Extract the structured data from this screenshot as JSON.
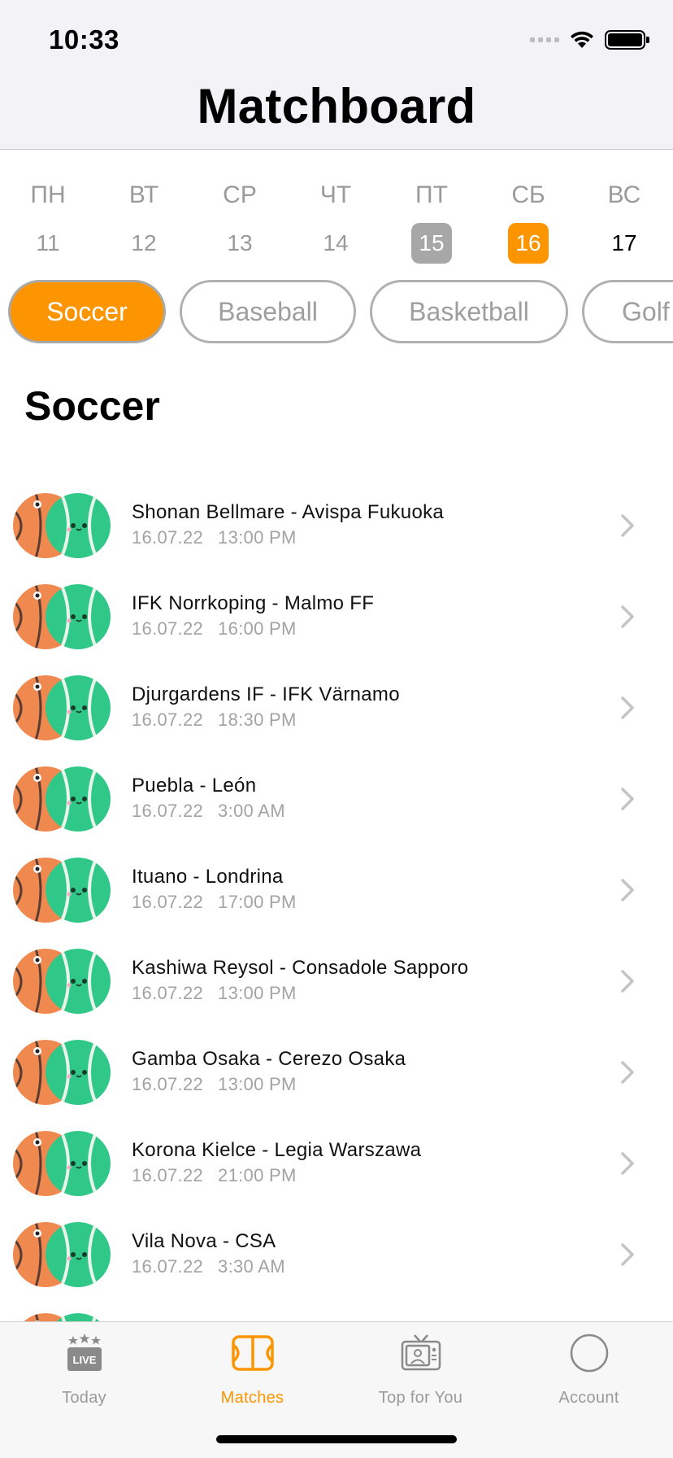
{
  "status_bar": {
    "time": "10:33"
  },
  "header": {
    "title": "Matchboard"
  },
  "week": [
    {
      "weekday": "ПН",
      "date": "11",
      "state": "normal"
    },
    {
      "weekday": "ВТ",
      "date": "12",
      "state": "normal"
    },
    {
      "weekday": "СР",
      "date": "13",
      "state": "normal"
    },
    {
      "weekday": "ЧТ",
      "date": "14",
      "state": "normal"
    },
    {
      "weekday": "ПТ",
      "date": "15",
      "state": "today"
    },
    {
      "weekday": "СБ",
      "date": "16",
      "state": "selected"
    },
    {
      "weekday": "ВС",
      "date": "17",
      "state": "upcoming"
    }
  ],
  "sports": [
    {
      "label": "Soccer",
      "active": true
    },
    {
      "label": "Baseball",
      "active": false
    },
    {
      "label": "Basketball",
      "active": false
    },
    {
      "label": "Golf",
      "active": false
    }
  ],
  "section_title": "Soccer",
  "matches": [
    {
      "teams": "Shonan Bellmare - Avispa Fukuoka",
      "date": "16.07.22",
      "time": "13:00 PM"
    },
    {
      "teams": "IFK Norrkoping - Malmo FF",
      "date": "16.07.22",
      "time": "16:00 PM"
    },
    {
      "teams": "Djurgardens IF - IFK Värnamo",
      "date": "16.07.22",
      "time": "18:30 PM"
    },
    {
      "teams": "Puebla - León",
      "date": "16.07.22",
      "time": "3:00 AM"
    },
    {
      "teams": "Ituano - Londrina",
      "date": "16.07.22",
      "time": "17:00 PM"
    },
    {
      "teams": "Kashiwa Reysol - Consadole Sapporo",
      "date": "16.07.22",
      "time": "13:00 PM"
    },
    {
      "teams": "Gamba Osaka - Cerezo Osaka",
      "date": "16.07.22",
      "time": "13:00 PM"
    },
    {
      "teams": "Korona Kielce - Legia Warszawa",
      "date": "16.07.22",
      "time": "21:00 PM"
    },
    {
      "teams": "Vila Nova - CSA",
      "date": "16.07.22",
      "time": "3:30 AM"
    }
  ],
  "tabs": [
    {
      "label": "Today",
      "icon": "live-stars-icon",
      "active": false
    },
    {
      "label": "Matches",
      "icon": "court-icon",
      "active": true
    },
    {
      "label": "Top for You",
      "icon": "tv-icon",
      "active": false
    },
    {
      "label": "Account",
      "icon": "account-circle-icon",
      "active": false
    }
  ],
  "colors": {
    "accent": "#fd9500",
    "muted": "#9a9a9a",
    "today_bg": "#a7a7a7"
  }
}
